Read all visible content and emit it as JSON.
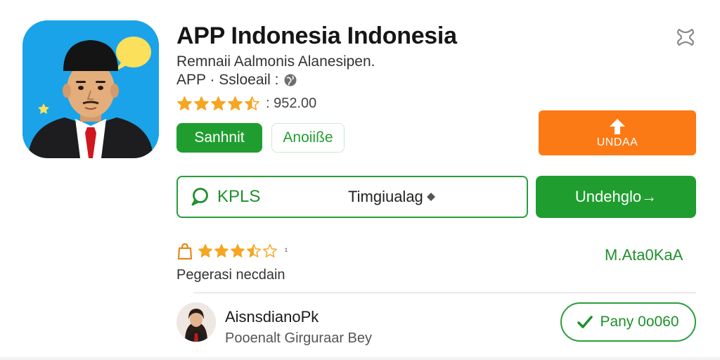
{
  "app": {
    "title": "APP Indonesia Indonesia",
    "subtitle": "Remnaii Aalmonis Alanesipen.",
    "meta": "APP · Ssloeail :",
    "globe_icon": "globe-icon",
    "rating_value": ": 952.00",
    "rating_stars": 4.5
  },
  "chips": {
    "primary_label": "Sanhnit",
    "secondary_label": "Anoiiße"
  },
  "install": {
    "label": "UNDAA",
    "icon": "upload-arrow-icon"
  },
  "kpls": {
    "label": "KPLS",
    "right_text": "Timgiualag",
    "icon": "chat-bubble-icon"
  },
  "download": {
    "label": "Undehglo→"
  },
  "review": {
    "stars": 3.5,
    "count": "¹",
    "tag": "M.Ata0KaA",
    "subtitle": "Pegerasi necdain"
  },
  "user": {
    "name": "AisnsdianoPk",
    "description": "Pooenalt Girguraar Bey"
  },
  "pay": {
    "label": "Pany 0o060"
  },
  "colors": {
    "green": "#1f9e2f",
    "orange": "#fb7a16",
    "star": "#f5a623",
    "icon_bg": "#1aa3e8"
  }
}
